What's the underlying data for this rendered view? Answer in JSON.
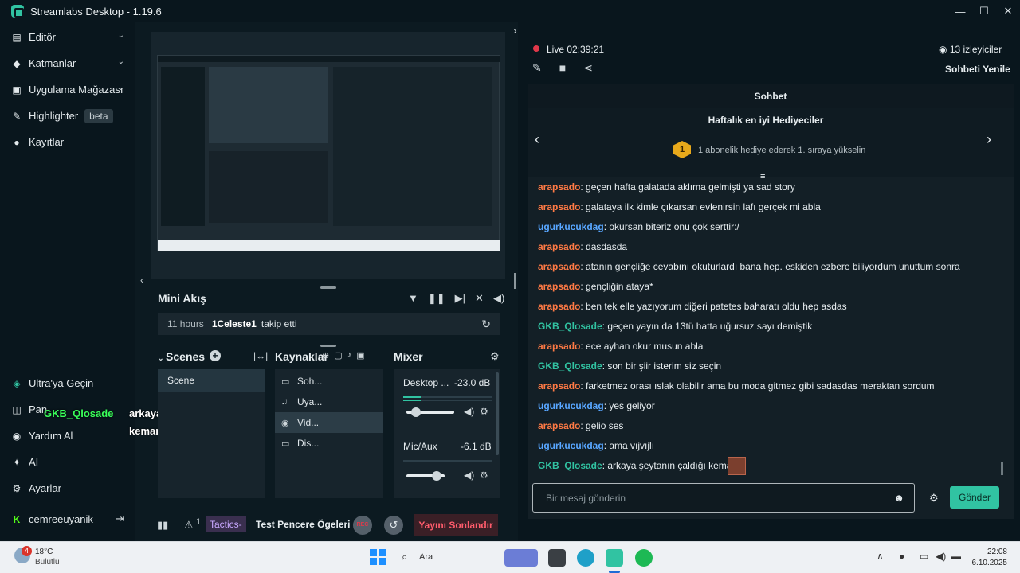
{
  "window": {
    "title": "Streamlabs Desktop - 1.19.6",
    "minimize": "—",
    "maximize": "☐",
    "close": "✕"
  },
  "sidebar": {
    "items": [
      {
        "label": "Editör",
        "icon": "editor-icon"
      },
      {
        "label": "Katmanlar",
        "icon": "layers-icon"
      },
      {
        "label": "Uygulama Mağazası",
        "icon": "app-store-icon"
      },
      {
        "label": "Highlighter",
        "icon": "highlighter-icon",
        "badge": "beta"
      },
      {
        "label": "Kayıtlar",
        "icon": "recordings-icon"
      }
    ],
    "bottom_items": [
      {
        "label": "Ultra'ya Geçin",
        "icon": "ultra-icon"
      },
      {
        "label": "Pan",
        "icon": "panel-icon"
      },
      {
        "label": "Yardım Al",
        "icon": "help-icon"
      },
      {
        "label": "AI",
        "icon": "ai-icon"
      },
      {
        "label": "Ayarlar",
        "icon": "settings-icon"
      }
    ],
    "user": "cemreeuyanik"
  },
  "overlay": {
    "username": "GKB_Qlosade",
    "message_line1": "arkaya şeytanın çaldığı",
    "message_line2": "keman."
  },
  "mini_feed": {
    "title": "Mini Akış",
    "time": "11 hours",
    "user": "1Celeste1",
    "action": "takip etti"
  },
  "scenes": {
    "title": "Scenes",
    "items": [
      "Scene"
    ]
  },
  "sources": {
    "title": "Kaynaklar",
    "items": [
      "Soh...",
      "Uya...",
      "Vid...",
      "Dis..."
    ]
  },
  "mixer": {
    "title": "Mixer",
    "channels": [
      {
        "name": "Desktop ...",
        "db": "-23.0 dB",
        "level": 0.2
      },
      {
        "name": "Mic/Aux",
        "db": "-6.1 dB",
        "level": 0.8
      }
    ]
  },
  "bottom_bar": {
    "alerts_count": "1",
    "tactics": "Tactics-",
    "test_label": "Test Pencere Ögeleri",
    "rec": "REC",
    "end_stream": "Yayını Sonlandır"
  },
  "stream": {
    "live_label": "Live",
    "time": "02:39:21",
    "viewers": "13 izleyiciler",
    "refresh_chat": "Sohbeti Yenile"
  },
  "chat": {
    "title": "Sohbet",
    "top_gifters_title": "Haftalık en iyi Hediyeciler",
    "gifter_rank": "1",
    "gifter_text": "1 abonelik hediye ederek 1. sıraya yükselin",
    "messages": [
      {
        "user": "arapsado",
        "color": "orange",
        "text": ": geçen hafta galatada aklıma gelmişti ya sad story"
      },
      {
        "user": "arapsado",
        "color": "orange",
        "text": ": galataya ilk kimle çıkarsan evlenirsin lafı gerçek mi abla"
      },
      {
        "user": "ugurkucukdag",
        "color": "blue",
        "text": ": okursan biteriz onu çok serttir:/"
      },
      {
        "user": "arapsado",
        "color": "orange",
        "text": ": dasdasda"
      },
      {
        "user": "arapsado",
        "color": "orange",
        "text": ": atanın gençliğe cevabını okuturlardı bana hep. eskiden ezbere biliyordum unuttum sonra"
      },
      {
        "user": "arapsado",
        "color": "orange",
        "text": ": gençliğin ataya*"
      },
      {
        "user": "arapsado",
        "color": "orange",
        "text": ": ben tek elle yazıyorum diğeri patetes baharatı oldu hep asdas"
      },
      {
        "user": "GKB_Qlosade",
        "color": "green",
        "text": ": geçen yayın da 13tü hatta uğursuz sayı demiştik"
      },
      {
        "user": "arapsado",
        "color": "orange",
        "text": ": ece ayhan okur musun abla"
      },
      {
        "user": "GKB_Qlosade",
        "color": "green",
        "text": ": son bir şiir isterim siz seçin"
      },
      {
        "user": "arapsado",
        "color": "orange",
        "text": ": farketmez orası ıslak olabilir ama bu moda gitmez gibi sadasdas meraktan sordum"
      },
      {
        "user": "ugurkucukdag",
        "color": "blue",
        "text": ": yes geliyor"
      },
      {
        "user": "arapsado",
        "color": "orange",
        "text": ": gelio ses"
      },
      {
        "user": "ugurkucukdag",
        "color": "blue",
        "text": ": ama vıjvıjlı"
      },
      {
        "user": "GKB_Qlosade",
        "color": "green",
        "text": ": arkaya şeytanın çaldığı keman."
      }
    ],
    "input_placeholder": "Bir mesaj gönderin",
    "send": "Gönder"
  },
  "taskbar": {
    "weather_temp": "18°C",
    "weather_desc": "Bulutlu",
    "weather_badge": "4",
    "search": "Ara",
    "time": "22:08",
    "date": "6.10.2025"
  },
  "colors": {
    "accent": "#31c3a2",
    "danger": "#e0384a",
    "orange_user": "#ff7a45",
    "blue_user": "#58a6ff"
  }
}
